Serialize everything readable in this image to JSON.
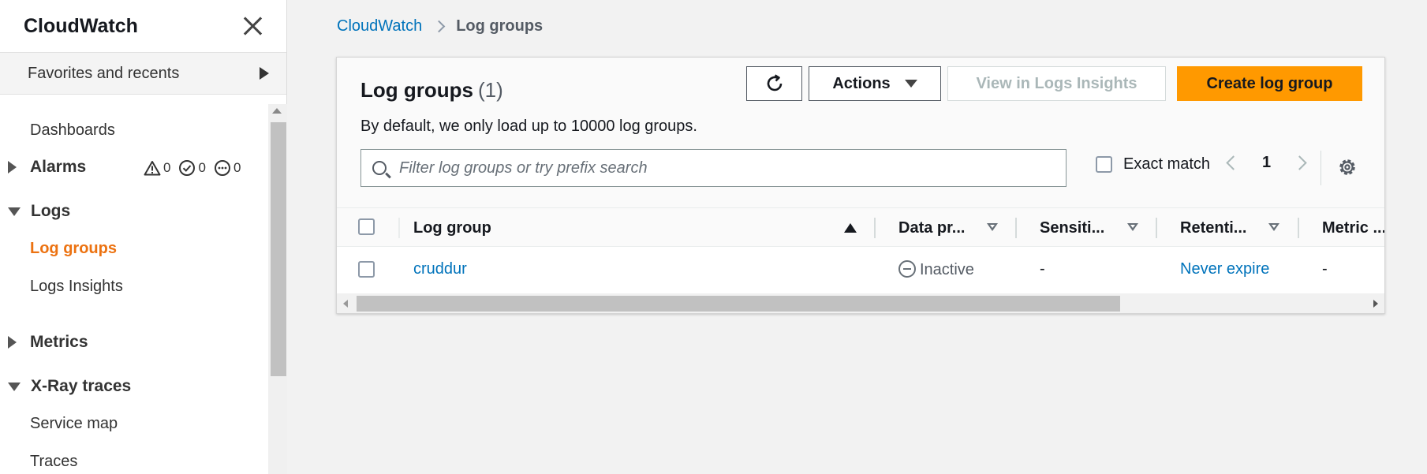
{
  "sidebar": {
    "title": "CloudWatch",
    "favorites_label": "Favorites and recents",
    "items": {
      "dashboards": "Dashboards",
      "alarms": "Alarms",
      "alarm_counts": [
        "0",
        "0",
        "0"
      ],
      "logs": "Logs",
      "log_groups": "Log groups",
      "logs_insights": "Logs Insights",
      "metrics": "Metrics",
      "xray": "X-Ray traces",
      "service_map": "Service map",
      "traces": "Traces"
    }
  },
  "breadcrumb": {
    "root": "CloudWatch",
    "current": "Log groups"
  },
  "panel": {
    "title": "Log groups",
    "count": "(1)",
    "description": "By default, we only load up to 10000 log groups.",
    "actions_label": "Actions",
    "insights_label": "View in Logs Insights",
    "create_label": "Create log group",
    "search_placeholder": "Filter log groups or try prefix search",
    "exact_match_label": "Exact match",
    "page": "1"
  },
  "table": {
    "columns": [
      "Log group",
      "Data pr...",
      "Sensiti...",
      "Retenti...",
      "Metric ..."
    ],
    "rows": [
      {
        "log_group": "cruddur",
        "data_protection": "Inactive",
        "sensitive": "-",
        "retention": "Never expire",
        "metric": "-"
      }
    ]
  },
  "colors": {
    "accent": "#ff9900",
    "link": "#0073bb",
    "active_nav": "#ec7211"
  }
}
